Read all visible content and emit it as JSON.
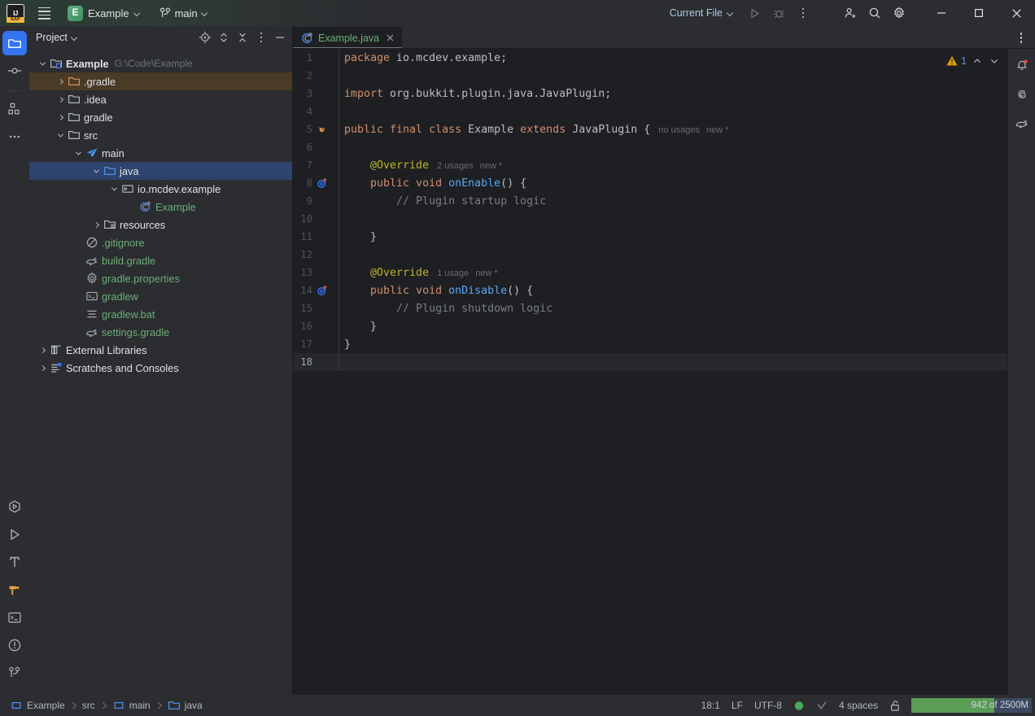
{
  "titlebar": {
    "logo_text": "IJ",
    "logo_badge": "EAP",
    "hamburger_name": "main-menu-icon",
    "project_initial": "E",
    "project_name": "Example",
    "branch_name": "main",
    "run_config": "Current File",
    "buttons": {
      "run": "run-button",
      "debug": "debug-button",
      "more": "more-actions-button",
      "code_with_me": "code-with-me-button",
      "search": "search-everywhere-button",
      "settings": "settings-button",
      "minimize": "minimize-button",
      "maximize": "maximize-button",
      "close": "close-button"
    }
  },
  "left_stripe": {
    "top": [
      {
        "name": "project-tool-window",
        "icon": "folder-icon",
        "active": true
      },
      {
        "name": "commit-tool-window",
        "icon": "commit-icon",
        "active": false
      },
      {
        "name": "structure-tool-window",
        "icon": "structure-icon",
        "active": false
      },
      {
        "name": "more-tool-windows",
        "icon": "ellipsis-icon",
        "active": false
      }
    ],
    "bottom": [
      {
        "name": "services-tool-window",
        "icon": "services-icon",
        "active": false
      },
      {
        "name": "run-tool-window",
        "icon": "play-icon",
        "active": false
      },
      {
        "name": "build-tool-window",
        "icon": "hammer-icon",
        "active": false
      },
      {
        "name": "gradle-tool-window",
        "icon": "gradle-hammer-icon",
        "active": true
      },
      {
        "name": "terminal-tool-window",
        "icon": "terminal-icon",
        "active": false
      },
      {
        "name": "problems-tool-window",
        "icon": "problems-icon",
        "active": false
      },
      {
        "name": "git-tool-window",
        "icon": "branch-icon",
        "active": false
      }
    ]
  },
  "project_panel": {
    "title": "Project",
    "tools": [
      {
        "name": "select-opened-file-button",
        "icon": "crosshair-icon"
      },
      {
        "name": "expand-collapse-button",
        "icon": "chevrons-updown-icon"
      },
      {
        "name": "collapse-all-button",
        "icon": "collapse-all-icon"
      },
      {
        "name": "panel-options-button",
        "icon": "ellipsis-vertical-icon"
      },
      {
        "name": "hide-panel-button",
        "icon": "minus-icon"
      }
    ],
    "tree": [
      {
        "indent": 0,
        "arrow": "down",
        "icon": "project-root-icon",
        "label": "Example",
        "sub": "G:\\Code\\Example",
        "style": "bold",
        "state": "normal"
      },
      {
        "indent": 1,
        "arrow": "right",
        "icon": "excluded-folder-icon",
        "label": ".gradle",
        "sub": "",
        "style": "excluded",
        "state": "highlight"
      },
      {
        "indent": 1,
        "arrow": "right",
        "icon": "folder-icon",
        "label": ".idea",
        "sub": "",
        "style": "normal",
        "state": "normal"
      },
      {
        "indent": 1,
        "arrow": "right",
        "icon": "folder-icon",
        "label": "gradle",
        "sub": "",
        "style": "normal",
        "state": "normal"
      },
      {
        "indent": 1,
        "arrow": "down",
        "icon": "folder-icon",
        "label": "src",
        "sub": "",
        "style": "normal",
        "state": "normal"
      },
      {
        "indent": 2,
        "arrow": "down",
        "icon": "source-root-icon",
        "label": "main",
        "sub": "",
        "style": "normal",
        "state": "normal"
      },
      {
        "indent": 3,
        "arrow": "down",
        "icon": "java-source-folder-icon",
        "label": "java",
        "sub": "",
        "style": "normal",
        "state": "selected"
      },
      {
        "indent": 4,
        "arrow": "down",
        "icon": "package-icon",
        "label": "io.mcdev.example",
        "sub": "",
        "style": "normal",
        "state": "normal"
      },
      {
        "indent": 5,
        "arrow": "none",
        "icon": "java-class-icon",
        "label": "Example",
        "sub": "",
        "style": "modified",
        "state": "normal"
      },
      {
        "indent": 3,
        "arrow": "right",
        "icon": "resource-root-icon",
        "label": "resources",
        "sub": "",
        "style": "normal",
        "state": "normal"
      },
      {
        "indent": 2,
        "arrow": "none",
        "icon": "gitignore-icon",
        "label": ".gitignore",
        "sub": "",
        "style": "modified",
        "state": "normal"
      },
      {
        "indent": 2,
        "arrow": "none",
        "icon": "gradle-file-icon",
        "label": "build.gradle",
        "sub": "",
        "style": "modified",
        "state": "normal"
      },
      {
        "indent": 2,
        "arrow": "none",
        "icon": "properties-icon",
        "label": "gradle.properties",
        "sub": "",
        "style": "modified",
        "state": "normal"
      },
      {
        "indent": 2,
        "arrow": "none",
        "icon": "shell-script-icon",
        "label": "gradlew",
        "sub": "",
        "style": "modified",
        "state": "normal"
      },
      {
        "indent": 2,
        "arrow": "none",
        "icon": "text-file-icon",
        "label": "gradlew.bat",
        "sub": "",
        "style": "modified",
        "state": "normal"
      },
      {
        "indent": 2,
        "arrow": "none",
        "icon": "gradle-file-icon",
        "label": "settings.gradle",
        "sub": "",
        "style": "modified",
        "state": "normal"
      },
      {
        "indent": 0,
        "arrow": "right",
        "icon": "library-icon",
        "label": "External Libraries",
        "sub": "",
        "style": "normal",
        "state": "normal"
      },
      {
        "indent": 0,
        "arrow": "right",
        "icon": "scratches-icon",
        "label": "Scratches and Consoles",
        "sub": "",
        "style": "normal",
        "state": "normal"
      }
    ]
  },
  "editor": {
    "tab": {
      "label": "Example.java",
      "icon": "java-class-icon",
      "close": "×"
    },
    "tab_options": "editor-options-button",
    "inspections": {
      "warning_count": "1",
      "warning_icon": "warning-triangle-icon",
      "prev": "previous-problem-button",
      "next": "next-problem-button"
    },
    "lines": [
      {
        "n": "1",
        "gutter": "",
        "tokens": [
          {
            "t": "package ",
            "c": "kw"
          },
          {
            "t": "io.mcdev.example;",
            "c": "type"
          }
        ],
        "current": false
      },
      {
        "n": "2",
        "gutter": "",
        "tokens": [],
        "current": false
      },
      {
        "n": "3",
        "gutter": "",
        "tokens": [
          {
            "t": "import ",
            "c": "kw"
          },
          {
            "t": "org.bukkit.plugin.java.JavaPlugin;",
            "c": "type"
          }
        ],
        "current": false
      },
      {
        "n": "4",
        "gutter": "",
        "tokens": [],
        "current": false
      },
      {
        "n": "5",
        "gutter": "bukkit-plugin-icon",
        "tokens": [
          {
            "t": "public final class ",
            "c": "kw"
          },
          {
            "t": "Example ",
            "c": "cls"
          },
          {
            "t": "extends ",
            "c": "kw"
          },
          {
            "t": "JavaPlugin {",
            "c": "type"
          },
          {
            "t": "no usages",
            "c": "hint"
          },
          {
            "t": "new *",
            "c": "hint2"
          }
        ],
        "current": false
      },
      {
        "n": "6",
        "gutter": "",
        "tokens": [],
        "current": false
      },
      {
        "n": "7",
        "gutter": "",
        "tokens": [
          {
            "t": "    @Override",
            "c": "anno"
          },
          {
            "t": "2 usages",
            "c": "hint"
          },
          {
            "t": "new *",
            "c": "hint2"
          }
        ],
        "current": false
      },
      {
        "n": "8",
        "gutter": "overriding-method-icon",
        "tokens": [
          {
            "t": "    public void ",
            "c": "kw"
          },
          {
            "t": "onEnable",
            "c": "mth"
          },
          {
            "t": "() {",
            "c": "type"
          }
        ],
        "current": false
      },
      {
        "n": "9",
        "gutter": "",
        "tokens": [
          {
            "t": "        // Plugin startup logic",
            "c": "cmt"
          }
        ],
        "current": false
      },
      {
        "n": "10",
        "gutter": "",
        "tokens": [],
        "current": false
      },
      {
        "n": "11",
        "gutter": "",
        "tokens": [
          {
            "t": "    }",
            "c": "type"
          }
        ],
        "current": false
      },
      {
        "n": "12",
        "gutter": "",
        "tokens": [],
        "current": false
      },
      {
        "n": "13",
        "gutter": "",
        "tokens": [
          {
            "t": "    @Override",
            "c": "anno"
          },
          {
            "t": "1 usage",
            "c": "hint"
          },
          {
            "t": "new *",
            "c": "hint2"
          }
        ],
        "current": false
      },
      {
        "n": "14",
        "gutter": "overriding-method-icon",
        "tokens": [
          {
            "t": "    public void ",
            "c": "kw"
          },
          {
            "t": "onDisable",
            "c": "mth"
          },
          {
            "t": "() {",
            "c": "type"
          }
        ],
        "current": false
      },
      {
        "n": "15",
        "gutter": "",
        "tokens": [
          {
            "t": "        // Plugin shutdown logic",
            "c": "cmt"
          }
        ],
        "current": false
      },
      {
        "n": "16",
        "gutter": "",
        "tokens": [
          {
            "t": "    }",
            "c": "type"
          }
        ],
        "current": false
      },
      {
        "n": "17",
        "gutter": "",
        "tokens": [
          {
            "t": "}",
            "c": "type"
          }
        ],
        "current": false
      },
      {
        "n": "18",
        "gutter": "",
        "tokens": [],
        "current": true
      }
    ]
  },
  "right_stripe": [
    {
      "name": "notifications-tool-window",
      "icon": "bell-icon",
      "badge": true
    },
    {
      "name": "ai-assistant-tool-window",
      "icon": "spiral-icon",
      "badge": false
    },
    {
      "name": "gradle-tool-window-right",
      "icon": "gradle-elephant-icon",
      "badge": false
    }
  ],
  "statusbar": {
    "breadcrumbs": [
      {
        "label": "Example",
        "icon": "module-icon"
      },
      {
        "label": "src",
        "icon": "none"
      },
      {
        "label": "main",
        "icon": "module-icon"
      },
      {
        "label": "java",
        "icon": "folder-blue-icon"
      }
    ],
    "caret_position": "18:1",
    "line_separator": "LF",
    "encoding": "UTF-8",
    "inspection_status_icon": "inspections-ok-icon",
    "inspection_status_color": "#49a85c",
    "git_check_icon": "checkmark-icon",
    "indent": "4 spaces",
    "lock_icon": "unlocked-icon",
    "memory": {
      "label": "942 of 2500M",
      "fill_percent": 69,
      "fill_color": "#5a9e55",
      "track_color": "#3b4a61"
    }
  }
}
